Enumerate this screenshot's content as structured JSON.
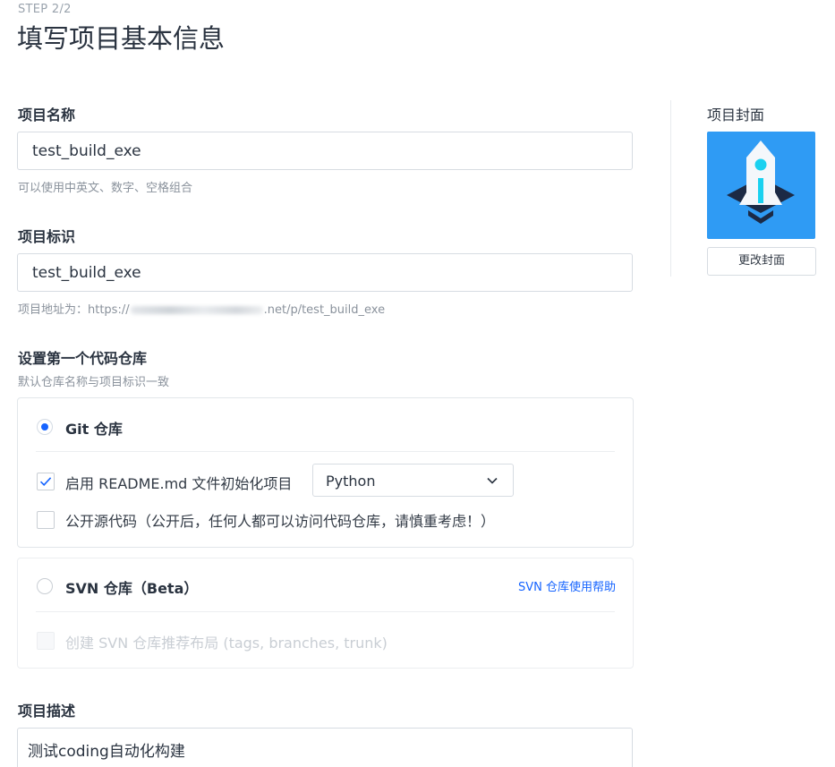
{
  "header": {
    "step": "STEP 2/2",
    "title": "填写项目基本信息"
  },
  "project_name": {
    "label": "项目名称",
    "value": "test_build_exe",
    "hint": "可以使用中英文、数字、空格组合"
  },
  "project_id": {
    "label": "项目标识",
    "value": "test_build_exe",
    "hint_prefix": "项目地址为：https://",
    "hint_suffix": ".net/p/test_build_exe"
  },
  "repo": {
    "label": "设置第一个代码仓库",
    "hint": "默认仓库名称与项目标识一致",
    "git": {
      "title": "Git 仓库",
      "selected": true,
      "readme_option": "启用 README.md 文件初始化项目",
      "readme_checked": true,
      "language": "Python",
      "public_option": "公开源代码（公开后，任何人都可以访问代码仓库，请慎重考虑！）",
      "public_checked": false
    },
    "svn": {
      "title": "SVN 仓库（Beta）",
      "selected": false,
      "help_link": "SVN 仓库使用帮助",
      "layout_option": "创建 SVN 仓库推荐布局 (tags, branches, trunk)"
    }
  },
  "description": {
    "label": "项目描述",
    "value": "测试coding自动化构建"
  },
  "cover": {
    "label": "项目封面",
    "change_button": "更改封面",
    "icon": "rocket-icon",
    "background_color": "#2f9bf4"
  },
  "colors": {
    "accent": "#1664ff"
  }
}
